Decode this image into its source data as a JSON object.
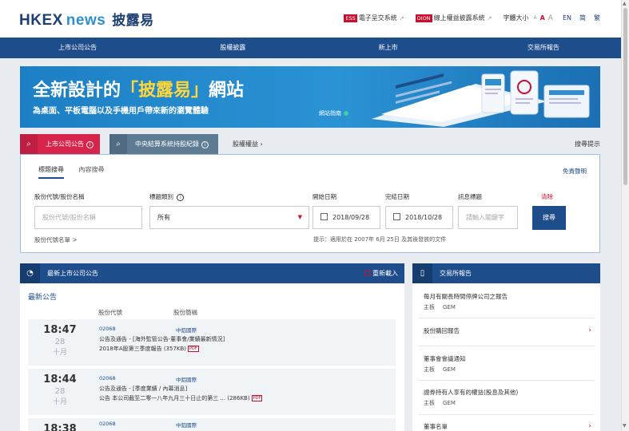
{
  "header": {
    "logo_hkex": "HKEX",
    "logo_news": "news",
    "logo_zh": "披露易",
    "links": [
      {
        "tag": "ESS",
        "label": "電子呈交系統",
        "color": "#c8102e"
      },
      {
        "tag": "DION",
        "label": "線上權益披露系統",
        "color": "#c8102e"
      }
    ],
    "font_size_label": "字體大小",
    "font_sizes": [
      "A",
      "A",
      "A"
    ],
    "languages": [
      "EN",
      "简",
      "繁"
    ]
  },
  "nav": [
    "上市公司公告",
    "股權披露",
    "新上市",
    "交易所報告"
  ],
  "banner": {
    "title_pre": "全新設計的",
    "title_hl": "「披露易」",
    "title_post": "網站",
    "subtitle": "為桌面、平板電腦以及手機用戶帶來新的瀏覽體驗",
    "guide": "網站指南",
    "colors": {
      "accent": "#ffd63a",
      "dot_active": "#c8102e",
      "dot_idle": "#9fc9ea"
    }
  },
  "tabs": {
    "listed": "上市公司公告",
    "ccass": "中央結算系統持股紀錄",
    "equity": "股權權益 ›",
    "tips": "搜尋提示"
  },
  "search": {
    "tab_active": "標題搜尋",
    "tab_other": "內容搜尋",
    "disclaimer": "免責聲明",
    "label_stock": "股份代號/股份名稱",
    "label_category": "標題類別",
    "label_from": "開始日期",
    "label_to": "完結日期",
    "label_keyword": "訊息標題",
    "clear": "清除",
    "stock_placeholder": "股份代號/股份名稱",
    "category_value": "所有",
    "from_value": "2018/09/28",
    "to_value": "2018/10/28",
    "keyword_placeholder": "請輸入關鍵字",
    "button": "搜尋",
    "stock_list": "股份代號名單 >",
    "hint": "提示：適用於在 2007年 6月 25日 及其後發放的文件"
  },
  "latest": {
    "title": "最新上市公司公告",
    "refresh": "重新載入",
    "heading": "最新公告",
    "col_code": "股份代號",
    "col_name": "股份簡稱",
    "rows": [
      {
        "time": "18:47",
        "day": "28",
        "month": "十月",
        "code": "02068",
        "name": "中鋁國際",
        "line1": "公告及通告 - [海外監管公告-董事會/業績最新情況]",
        "line2": "2018年A股第三季度報告 (357KB)",
        "badge": "PDF"
      },
      {
        "time": "18:44",
        "day": "28",
        "month": "十月",
        "code": "02068",
        "name": "中鋁國際",
        "line1": "公告及通告 - [季度業績 / 內幕消息]",
        "line2": "公告 本公司截至二零一八年九月三十日止的第三 ... (286KB)",
        "badge": "PDF"
      },
      {
        "time": "18:38",
        "day": "",
        "month": "",
        "code": "02068",
        "name": "中鋁國際",
        "line1": "",
        "line2": "",
        "badge": ""
      }
    ]
  },
  "reports": {
    "title": "交易所報告",
    "items": [
      {
        "label": "每月有關長時間停牌公司之報告",
        "sub": [
          "主板",
          "GEM"
        ],
        "chevron": false
      },
      {
        "label": "股份購回報告",
        "sub": [],
        "chevron": true
      },
      {
        "label": "董事會會議通知",
        "sub": [
          "主板",
          "GEM"
        ],
        "chevron": false
      },
      {
        "label": "證券持有人享有的權益(股息及其他)",
        "sub": [
          "主板",
          "GEM"
        ],
        "chevron": false
      },
      {
        "label": "董事名單",
        "sub": [],
        "chevron": true
      }
    ]
  }
}
